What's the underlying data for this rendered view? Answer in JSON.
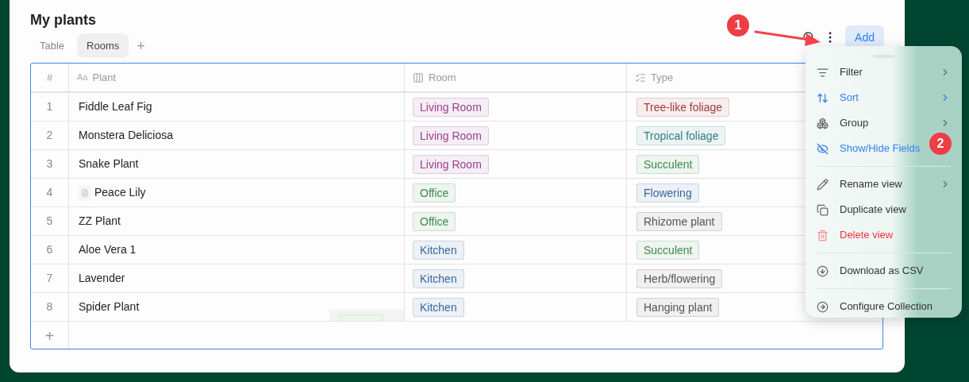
{
  "title": "My plants",
  "tabs": [
    {
      "label": "Table",
      "selected": false
    },
    {
      "label": "Rooms",
      "selected": true
    }
  ],
  "add_tab": "+",
  "toolbar": {
    "add_button": "Add"
  },
  "table": {
    "columns": [
      {
        "label": "#"
      },
      {
        "label": "Plant",
        "prefix": "Aa"
      },
      {
        "label": "Room"
      },
      {
        "label": "Type"
      }
    ],
    "rows": [
      {
        "number": "1",
        "plant": "Fiddle Leaf Fig",
        "has_note": false,
        "room": {
          "label": "Living Room",
          "color": "#9b3e8f"
        },
        "type": {
          "label": "Tree-like foliage",
          "color": "#a33a3a"
        }
      },
      {
        "number": "2",
        "plant": "Monstera Deliciosa",
        "has_note": false,
        "room": {
          "label": "Living Room",
          "color": "#9b3e8f"
        },
        "type": {
          "label": "Tropical foliage",
          "color": "#2f7e80"
        }
      },
      {
        "number": "3",
        "plant": "Snake Plant",
        "has_note": false,
        "room": {
          "label": "Living Room",
          "color": "#9b3e8f"
        },
        "type": {
          "label": "Succulent",
          "color": "#3c8a4c"
        }
      },
      {
        "number": "4",
        "plant": "Peace Lily",
        "has_note": true,
        "room": {
          "label": "Office",
          "color": "#3c8a4c"
        },
        "type": {
          "label": "Flowering",
          "color": "#34679f"
        }
      },
      {
        "number": "5",
        "plant": "ZZ Plant",
        "has_note": false,
        "room": {
          "label": "Office",
          "color": "#3c8a4c"
        },
        "type": {
          "label": "Rhizome plant",
          "color": "#555555"
        }
      },
      {
        "number": "6",
        "plant": "Aloe Vera 1",
        "has_note": false,
        "room": {
          "label": "Kitchen",
          "color": "#34679f"
        },
        "type": {
          "label": "Succulent",
          "color": "#3c8a4c"
        }
      },
      {
        "number": "7",
        "plant": "Lavender",
        "has_note": false,
        "room": {
          "label": "Kitchen",
          "color": "#34679f"
        },
        "type": {
          "label": "Herb/flowering",
          "color": "#555555"
        }
      },
      {
        "number": "8",
        "plant": "Spider Plant",
        "has_note": false,
        "room": {
          "label": "Kitchen",
          "color": "#34679f"
        },
        "type": {
          "label": "Hanging plant",
          "color": "#555555"
        }
      }
    ],
    "add_row": "+"
  },
  "menu": {
    "groups": [
      [
        {
          "label": "Filter",
          "kind": "normal",
          "submenu": true
        },
        {
          "label": "Sort",
          "kind": "accent",
          "submenu": true
        },
        {
          "label": "Group",
          "kind": "normal",
          "submenu": true
        },
        {
          "label": "Show/Hide Fields",
          "kind": "accent",
          "submenu": false
        }
      ],
      [
        {
          "label": "Rename view",
          "kind": "normal",
          "submenu": true
        },
        {
          "label": "Duplicate view",
          "kind": "normal",
          "submenu": false
        },
        {
          "label": "Delete view",
          "kind": "danger",
          "submenu": false
        }
      ],
      [
        {
          "label": "Download as CSV",
          "kind": "normal",
          "submenu": false
        }
      ],
      [
        {
          "label": "Configure Collection",
          "kind": "normal",
          "submenu": false
        }
      ]
    ]
  },
  "annotations": [
    {
      "label": "1"
    },
    {
      "label": "2"
    }
  ]
}
